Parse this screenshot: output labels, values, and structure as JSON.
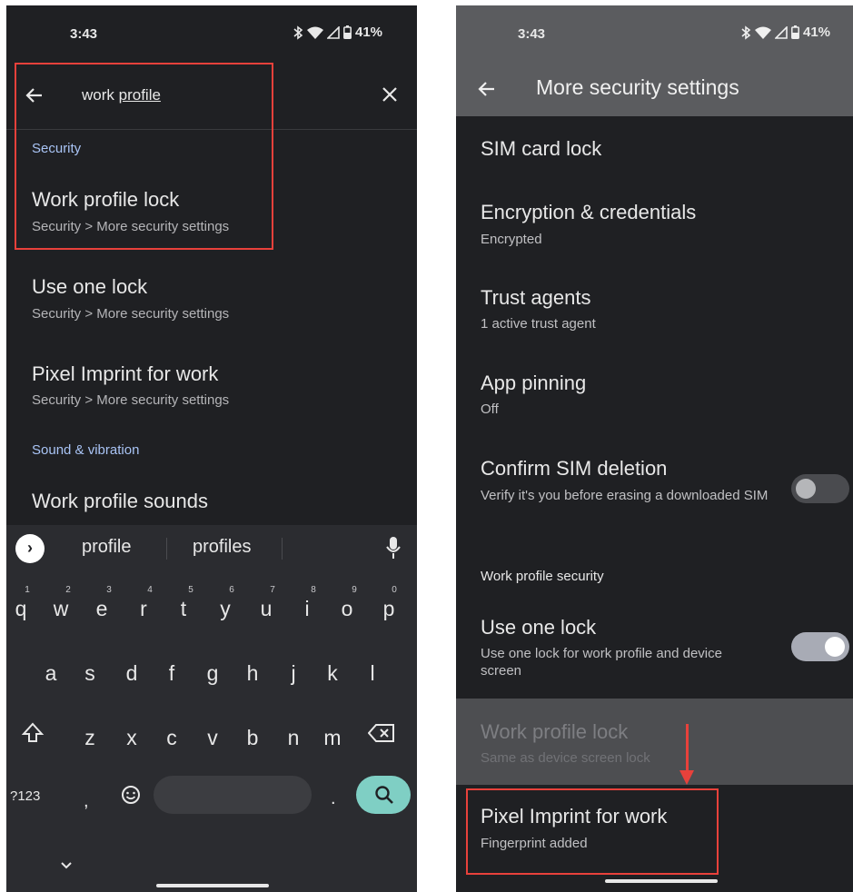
{
  "left_screen": {
    "status": {
      "time": "3:43",
      "battery": "41%"
    },
    "search": {
      "query_prefix": "work ",
      "query_underlined": "profile"
    },
    "results": {
      "security_header": "Security",
      "items": [
        {
          "title": "Work profile lock",
          "path": "Security > More security settings"
        },
        {
          "title": "Use one lock",
          "path": "Security > More security settings"
        },
        {
          "title": "Pixel Imprint for work",
          "path": "Security > More security settings"
        }
      ],
      "sound_header": "Sound & vibration",
      "sound_item_title": "Work profile sounds"
    },
    "keyboard": {
      "suggestions": [
        "profile",
        "profiles"
      ],
      "row1": [
        "q",
        "w",
        "e",
        "r",
        "t",
        "y",
        "u",
        "i",
        "o",
        "p"
      ],
      "row1_hints": [
        "1",
        "2",
        "3",
        "4",
        "5",
        "6",
        "7",
        "8",
        "9",
        "0"
      ],
      "row2": [
        "a",
        "s",
        "d",
        "f",
        "g",
        "h",
        "j",
        "k",
        "l"
      ],
      "row3": [
        "z",
        "x",
        "c",
        "v",
        "b",
        "n",
        "m"
      ],
      "symbols_key": "?123",
      "comma": ",",
      "period": "."
    },
    "icons": [
      "back-arrow-icon",
      "close-icon",
      "bluetooth-icon",
      "wifi-icon",
      "signal-icon",
      "battery-icon",
      "chevron-right-icon",
      "mic-icon",
      "shift-icon",
      "backspace-icon",
      "emoji-icon",
      "search-icon",
      "chevron-down-icon"
    ]
  },
  "right_screen": {
    "status": {
      "time": "3:43",
      "battery": "41%"
    },
    "appbar": {
      "title": "More security settings"
    },
    "items": [
      {
        "title": "SIM card lock",
        "subtitle": ""
      },
      {
        "title": "Encryption & credentials",
        "subtitle": "Encrypted"
      },
      {
        "title": "Trust agents",
        "subtitle": "1 active trust agent"
      },
      {
        "title": "App pinning",
        "subtitle": "Off"
      },
      {
        "title": "Confirm SIM deletion",
        "subtitle": "Verify it's you before erasing a downloaded SIM",
        "toggle_on": false
      }
    ],
    "work_section": {
      "header": "Work profile security",
      "use_one_lock": {
        "title": "Use one lock",
        "subtitle": "Use one lock for work profile and device screen",
        "toggle_on": true
      },
      "work_profile_lock": {
        "title": "Work profile lock",
        "subtitle": "Same as device screen lock",
        "disabled": true
      },
      "pixel_imprint": {
        "title": "Pixel Imprint for work",
        "subtitle": "Fingerprint added"
      }
    }
  },
  "colors": {
    "highlight_red": "#e8413b",
    "section_blue": "#a9c4f5",
    "background_dark": "#1f2023",
    "appbar_gray": "#5b5c5f",
    "enter_key_teal": "#7fcfc4"
  }
}
